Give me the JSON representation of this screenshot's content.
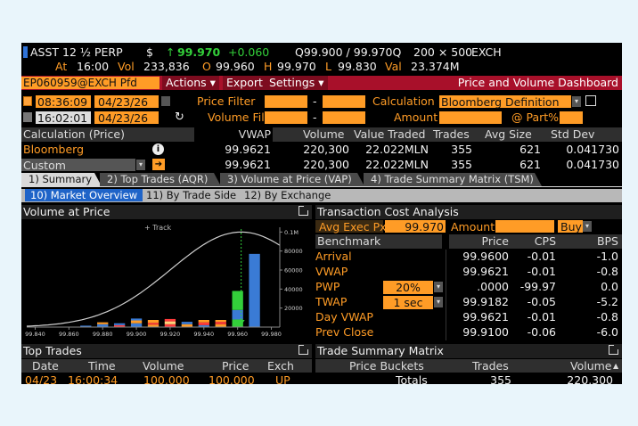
{
  "ticker": {
    "security": "ASST 12 ½ PERP",
    "currency": "$",
    "last_arrow": "↑",
    "last": "99.970",
    "change": "+0.060",
    "bid_ask": "Q99.900 / 99.970Q",
    "size": "200 × 500",
    "exchange": "EXCH",
    "line2": {
      "at_label": "At",
      "at_time": "16:00",
      "vol_label": "Vol",
      "vol": "233,836",
      "o_label": "O",
      "open": "99.960",
      "h_label": "H",
      "high": "99.970",
      "l_label": "L",
      "low": "99.830",
      "val_label": "Val",
      "value": "23.374M"
    }
  },
  "toolbar": {
    "security_id": "EP060959@EXCH Pfd",
    "actions": "Actions ▾",
    "export": "Export",
    "settings": "Settings ▾",
    "title": "Price and Volume Dashboard"
  },
  "filters": {
    "start_time": "08:36:09",
    "start_date": "04/23/26",
    "end_time": "16:02:01",
    "end_date": "04/23/26",
    "price_filter": "Price Filter",
    "volume_filter": "Volume Filter",
    "dash": "-",
    "calculation_label": "Calculation",
    "calculation_value": "Bloomberg Definition",
    "amount_label": "Amount",
    "part_label": "@ Part%"
  },
  "calc_table": {
    "headers": [
      "Calculation (Price)",
      "VWAP",
      "Volume",
      "Value Traded",
      "Trades",
      "Avg Size",
      "Std Dev"
    ],
    "rows": [
      {
        "name": "Bloomberg",
        "vwap": "99.9621",
        "volume": "220,300",
        "value": "22.022MLN",
        "trades": "355",
        "avg": "621",
        "std": "0.041730"
      },
      {
        "name": "Custom",
        "vwap": "99.9621",
        "volume": "220,300",
        "value": "22.022MLN",
        "trades": "355",
        "avg": "621",
        "std": "0.041730"
      }
    ]
  },
  "tabs": [
    "1) Summary",
    "2) Top Trades (AQR)",
    "3) Volume at Price (VAP)",
    "4) Trade Summary Matrix (TSM)"
  ],
  "subtabs": [
    "10) Market Overview",
    "11) By Trade Side",
    "12) By Exchange"
  ],
  "vap_panel": {
    "title": "Volume at Price",
    "track": "+ Track"
  },
  "chart_data": {
    "type": "bar",
    "title": "Volume at Price",
    "xlabel": "",
    "ylabel": "",
    "x_ticks": [
      "99.840",
      "99.860",
      "99.880",
      "99.900",
      "99.920",
      "99.940",
      "99.960",
      "99.980"
    ],
    "y_ticks": [
      "20000",
      "40000",
      "60000",
      "80000",
      "0.1M"
    ],
    "ylim": [
      0,
      105000
    ],
    "bars": [
      {
        "price": 99.87,
        "segments": [
          {
            "color": "#3a7bd5",
            "value": 1500
          }
        ]
      },
      {
        "price": 99.88,
        "segments": [
          {
            "color": "#3a7bd5",
            "value": 3000
          },
          {
            "color": "#ff9c26",
            "value": 2000
          }
        ]
      },
      {
        "price": 99.89,
        "segments": [
          {
            "color": "#ff3b3b",
            "value": 2000
          },
          {
            "color": "#3a7bd5",
            "value": 2000
          }
        ]
      },
      {
        "price": 99.9,
        "segments": [
          {
            "color": "#3a7bd5",
            "value": 4000
          },
          {
            "color": "#ff9c26",
            "value": 3000
          },
          {
            "color": "#3a7bd5",
            "value": 2000
          }
        ]
      },
      {
        "price": 99.91,
        "segments": [
          {
            "color": "#ff9c26",
            "value": 2500
          },
          {
            "color": "#ff3b3b",
            "value": 2000
          },
          {
            "color": "#ff9c26",
            "value": 3000
          }
        ]
      },
      {
        "price": 99.92,
        "segments": [
          {
            "color": "#ff3b3b",
            "value": 3000
          },
          {
            "color": "#ffd27a",
            "value": 3000
          },
          {
            "color": "#ff3b3b",
            "value": 2500
          }
        ]
      },
      {
        "price": 99.93,
        "segments": [
          {
            "color": "#ff9c26",
            "value": 3000
          },
          {
            "color": "#3a7bd5",
            "value": 2500
          }
        ]
      },
      {
        "price": 99.94,
        "segments": [
          {
            "color": "#3a7bd5",
            "value": 2000
          },
          {
            "color": "#ff3b3b",
            "value": 3000
          },
          {
            "color": "#ff9c26",
            "value": 2500
          }
        ]
      },
      {
        "price": 99.95,
        "segments": [
          {
            "color": "#ff9c26",
            "value": 3000
          },
          {
            "color": "#ff3b3b",
            "value": 2500
          },
          {
            "color": "#ff9c26",
            "value": 2000
          }
        ]
      },
      {
        "price": 99.96,
        "segments": [
          {
            "color": "#33d03a",
            "value": 8000
          },
          {
            "color": "#3a7bd5",
            "value": 10000
          },
          {
            "color": "#33d03a",
            "value": 20000
          }
        ]
      },
      {
        "price": 99.97,
        "segments": [
          {
            "color": "#3a7bd5",
            "value": 77000
          }
        ]
      }
    ],
    "curve": "normal",
    "vwap_marker": 99.9621,
    "grid": false,
    "legend": "none"
  },
  "tca_panel": {
    "title": "Transaction Cost Analysis",
    "avg_exec_label": "Avg Exec Px",
    "avg_exec_value": "99.970",
    "amount_label": "Amount",
    "side": "Buy",
    "headers": [
      "Benchmark",
      "Price",
      "CPS",
      "BPS"
    ],
    "rows": [
      {
        "name": "Arrival",
        "input": "",
        "price": "99.9600",
        "cps": "-0.01",
        "bps": "-1.0"
      },
      {
        "name": "VWAP",
        "input": "",
        "price": "99.9621",
        "cps": "-0.01",
        "bps": "-0.8"
      },
      {
        "name": "PWP",
        "input": "20%",
        "price": ".0000",
        "cps": "-99.97",
        "bps": "0.0"
      },
      {
        "name": "TWAP",
        "input": "1 sec",
        "price": "99.9182",
        "cps": "-0.05",
        "bps": "-5.2"
      },
      {
        "name": "Day VWAP",
        "input": "",
        "price": "99.9621",
        "cps": "-0.01",
        "bps": "-0.8"
      },
      {
        "name": "Prev Close",
        "input": "",
        "price": "99.9100",
        "cps": "-0.06",
        "bps": "-6.0"
      }
    ]
  },
  "top_trades": {
    "title": "Top Trades",
    "headers": [
      "Date",
      "Time",
      "Volume",
      "Price",
      "Exch"
    ],
    "row": {
      "date": "04/23",
      "time": "16:00:34",
      "volume": "100,000",
      "price": "100.000",
      "exch": "UP"
    }
  },
  "tsm_panel": {
    "title": "Trade Summary Matrix",
    "headers": [
      "Price Buckets",
      "Trades",
      "Volume"
    ],
    "totals": {
      "label": "Totals",
      "trades": "355",
      "volume": "220,300"
    }
  }
}
